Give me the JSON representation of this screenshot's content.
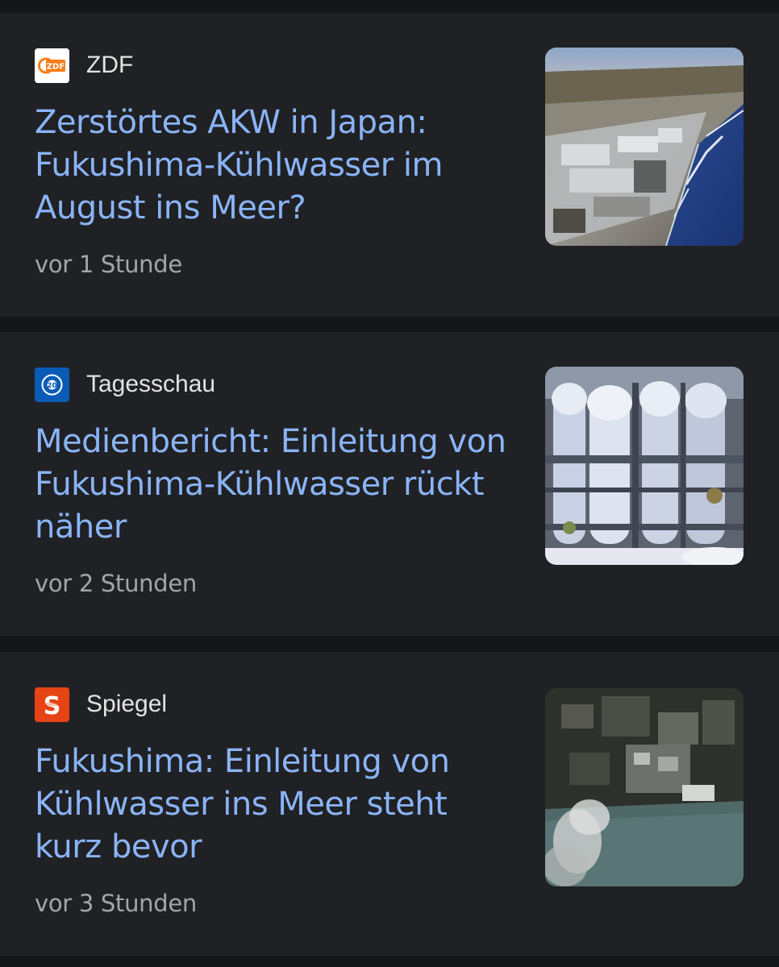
{
  "articles": [
    {
      "source": "ZDF",
      "source_icon": "zdf-logo-icon",
      "title": "Zerstörtes AKW in Japan: Fukushima-Kühlwasser im August ins Meer?",
      "time": "vor 1 Stunde",
      "thumbnail": "aerial-view-of-fukushima-power-plant-coast-image"
    },
    {
      "source": "Tagesschau",
      "source_icon": "tagesschau-logo-icon",
      "title": "Medienbericht: Einleitung von Fukushima-Kühlwasser rückt näher",
      "time": "vor 2 Stunden",
      "thumbnail": "water-treatment-tanks-and-pipes-image"
    },
    {
      "source": "Spiegel",
      "source_icon": "spiegel-logo-icon",
      "title": "Fukushima: Einleitung von Kühlwasser ins Meer steht kurz bevor",
      "time": "vor 3 Stunden",
      "thumbnail": "satellite-view-of-damaged-plant-with-smoke-image"
    }
  ],
  "colors": {
    "background": "#151618",
    "card": "#202124",
    "headline": "#8ab4f8",
    "source_text": "#e3e3e3",
    "timestamp": "#a3a5a8",
    "zdf_orange": "#fa7d19",
    "tagesschau_blue": "#0a5bb5",
    "spiegel_orange": "#e64415"
  }
}
